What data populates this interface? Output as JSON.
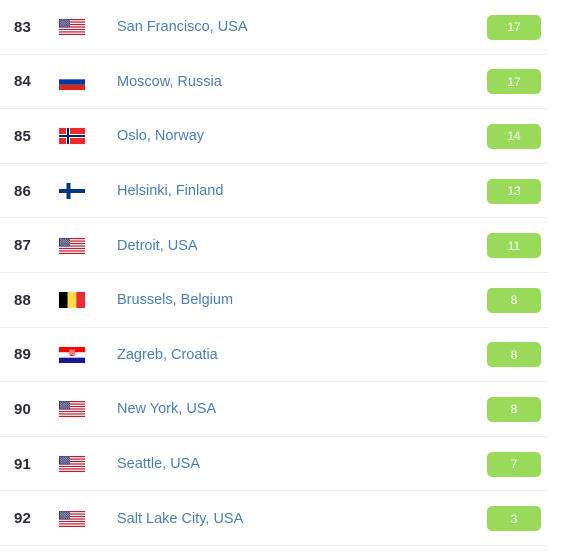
{
  "list": {
    "name": "city-ranking-list",
    "badge_color": "#9ada5a",
    "badge_text_color": "#ffffff",
    "city_text_color": "#4a7eb8",
    "rank_text_color": "#2d2d3a",
    "divider_color": "#ececec",
    "rows": [
      {
        "rank": "83",
        "flag": "flag-usa",
        "flag_label": "United States flag",
        "city": "San Francisco, USA",
        "score": "17"
      },
      {
        "rank": "84",
        "flag": "flag-russia",
        "flag_label": "Russia flag",
        "city": "Moscow, Russia",
        "score": "17"
      },
      {
        "rank": "85",
        "flag": "flag-norway",
        "flag_label": "Norway flag",
        "city": "Oslo, Norway",
        "score": "14"
      },
      {
        "rank": "86",
        "flag": "flag-finland",
        "flag_label": "Finland flag",
        "city": "Helsinki, Finland",
        "score": "13"
      },
      {
        "rank": "87",
        "flag": "flag-usa",
        "flag_label": "United States flag",
        "city": "Detroit, USA",
        "score": "11"
      },
      {
        "rank": "88",
        "flag": "flag-belgium",
        "flag_label": "Belgium flag",
        "city": "Brussels, Belgium",
        "score": "8"
      },
      {
        "rank": "89",
        "flag": "flag-croatia",
        "flag_label": "Croatia flag",
        "city": "Zagreb, Croatia",
        "score": "8"
      },
      {
        "rank": "90",
        "flag": "flag-usa",
        "flag_label": "United States flag",
        "city": "New York, USA",
        "score": "8"
      },
      {
        "rank": "91",
        "flag": "flag-usa",
        "flag_label": "United States flag",
        "city": "Seattle, USA",
        "score": "7"
      },
      {
        "rank": "92",
        "flag": "flag-usa",
        "flag_label": "United States flag",
        "city": "Salt Lake City, USA",
        "score": "3"
      }
    ]
  }
}
